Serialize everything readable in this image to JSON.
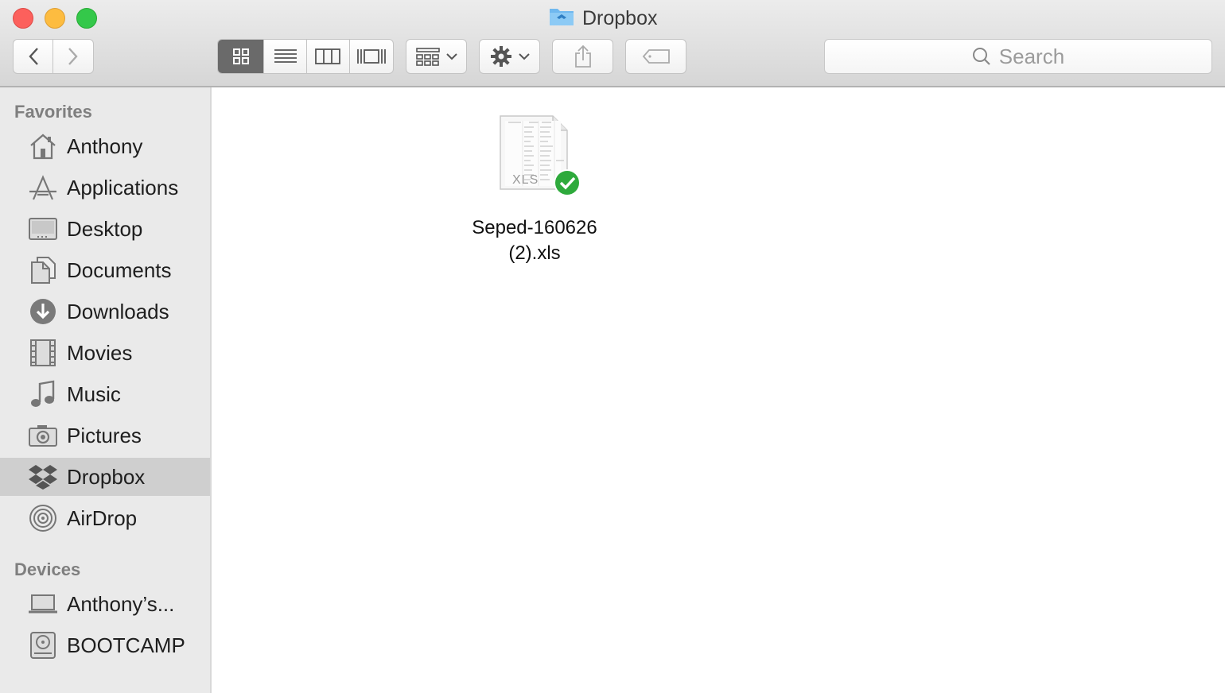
{
  "window": {
    "title": "Dropbox"
  },
  "toolbar": {
    "back_label": "Back",
    "forward_label": "Forward",
    "view_modes": [
      "icon-view",
      "list-view",
      "column-view",
      "cover-flow-view"
    ],
    "active_view": "icon-view",
    "search_placeholder": "Search"
  },
  "sidebar": {
    "favorites_header": "Favorites",
    "favorites": [
      {
        "label": "Anthony",
        "icon": "home-icon"
      },
      {
        "label": "Applications",
        "icon": "applications-icon"
      },
      {
        "label": "Desktop",
        "icon": "desktop-icon"
      },
      {
        "label": "Documents",
        "icon": "documents-icon"
      },
      {
        "label": "Downloads",
        "icon": "downloads-icon"
      },
      {
        "label": "Movies",
        "icon": "movies-icon"
      },
      {
        "label": "Music",
        "icon": "music-icon"
      },
      {
        "label": "Pictures",
        "icon": "pictures-icon"
      },
      {
        "label": "Dropbox",
        "icon": "dropbox-icon",
        "selected": true
      },
      {
        "label": "AirDrop",
        "icon": "airdrop-icon"
      }
    ],
    "devices_header": "Devices",
    "devices": [
      {
        "label": "Anthony’s...",
        "icon": "laptop-icon"
      },
      {
        "label": "BOOTCAMP",
        "icon": "disk-icon"
      }
    ]
  },
  "files": [
    {
      "name_line1": "Seped-160626",
      "name_line2": "(2).xls",
      "type_label": "XLS",
      "sync_status": "synced"
    }
  ],
  "colors": {
    "selected_row": "#cfcfcf",
    "sync_green": "#2eaa3c",
    "dropbox_blue": "#5aaee8"
  }
}
